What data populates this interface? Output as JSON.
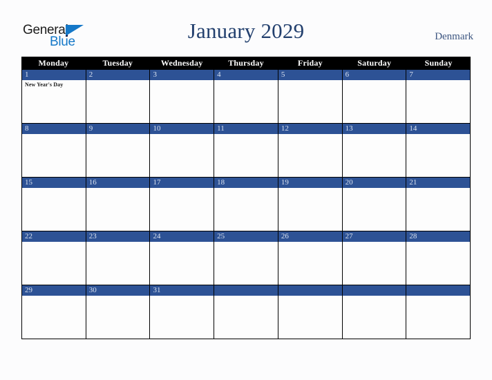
{
  "brand": {
    "word_general": "General",
    "word_blue": "Blue",
    "triangle_color": "#1578c8"
  },
  "header": {
    "title": "January 2029",
    "country": "Denmark",
    "title_color": "#23406e",
    "country_color": "#3c5580"
  },
  "calendar": {
    "weekday_headers": [
      "Monday",
      "Tuesday",
      "Wednesday",
      "Thursday",
      "Friday",
      "Saturday",
      "Sunday"
    ],
    "header_bg": "#000000",
    "date_band_color": "#2d5295",
    "date_text_color": "#dbe3f0",
    "weeks": [
      [
        {
          "day": "1",
          "events": [
            "New Year's Day"
          ]
        },
        {
          "day": "2",
          "events": []
        },
        {
          "day": "3",
          "events": []
        },
        {
          "day": "4",
          "events": []
        },
        {
          "day": "5",
          "events": []
        },
        {
          "day": "6",
          "events": []
        },
        {
          "day": "7",
          "events": []
        }
      ],
      [
        {
          "day": "8",
          "events": []
        },
        {
          "day": "9",
          "events": []
        },
        {
          "day": "10",
          "events": []
        },
        {
          "day": "11",
          "events": []
        },
        {
          "day": "12",
          "events": []
        },
        {
          "day": "13",
          "events": []
        },
        {
          "day": "14",
          "events": []
        }
      ],
      [
        {
          "day": "15",
          "events": []
        },
        {
          "day": "16",
          "events": []
        },
        {
          "day": "17",
          "events": []
        },
        {
          "day": "18",
          "events": []
        },
        {
          "day": "19",
          "events": []
        },
        {
          "day": "20",
          "events": []
        },
        {
          "day": "21",
          "events": []
        }
      ],
      [
        {
          "day": "22",
          "events": []
        },
        {
          "day": "23",
          "events": []
        },
        {
          "day": "24",
          "events": []
        },
        {
          "day": "25",
          "events": []
        },
        {
          "day": "26",
          "events": []
        },
        {
          "day": "27",
          "events": []
        },
        {
          "day": "28",
          "events": []
        }
      ],
      [
        {
          "day": "29",
          "events": []
        },
        {
          "day": "30",
          "events": []
        },
        {
          "day": "31",
          "events": []
        },
        {
          "day": "",
          "events": []
        },
        {
          "day": "",
          "events": []
        },
        {
          "day": "",
          "events": []
        },
        {
          "day": "",
          "events": []
        }
      ]
    ]
  }
}
